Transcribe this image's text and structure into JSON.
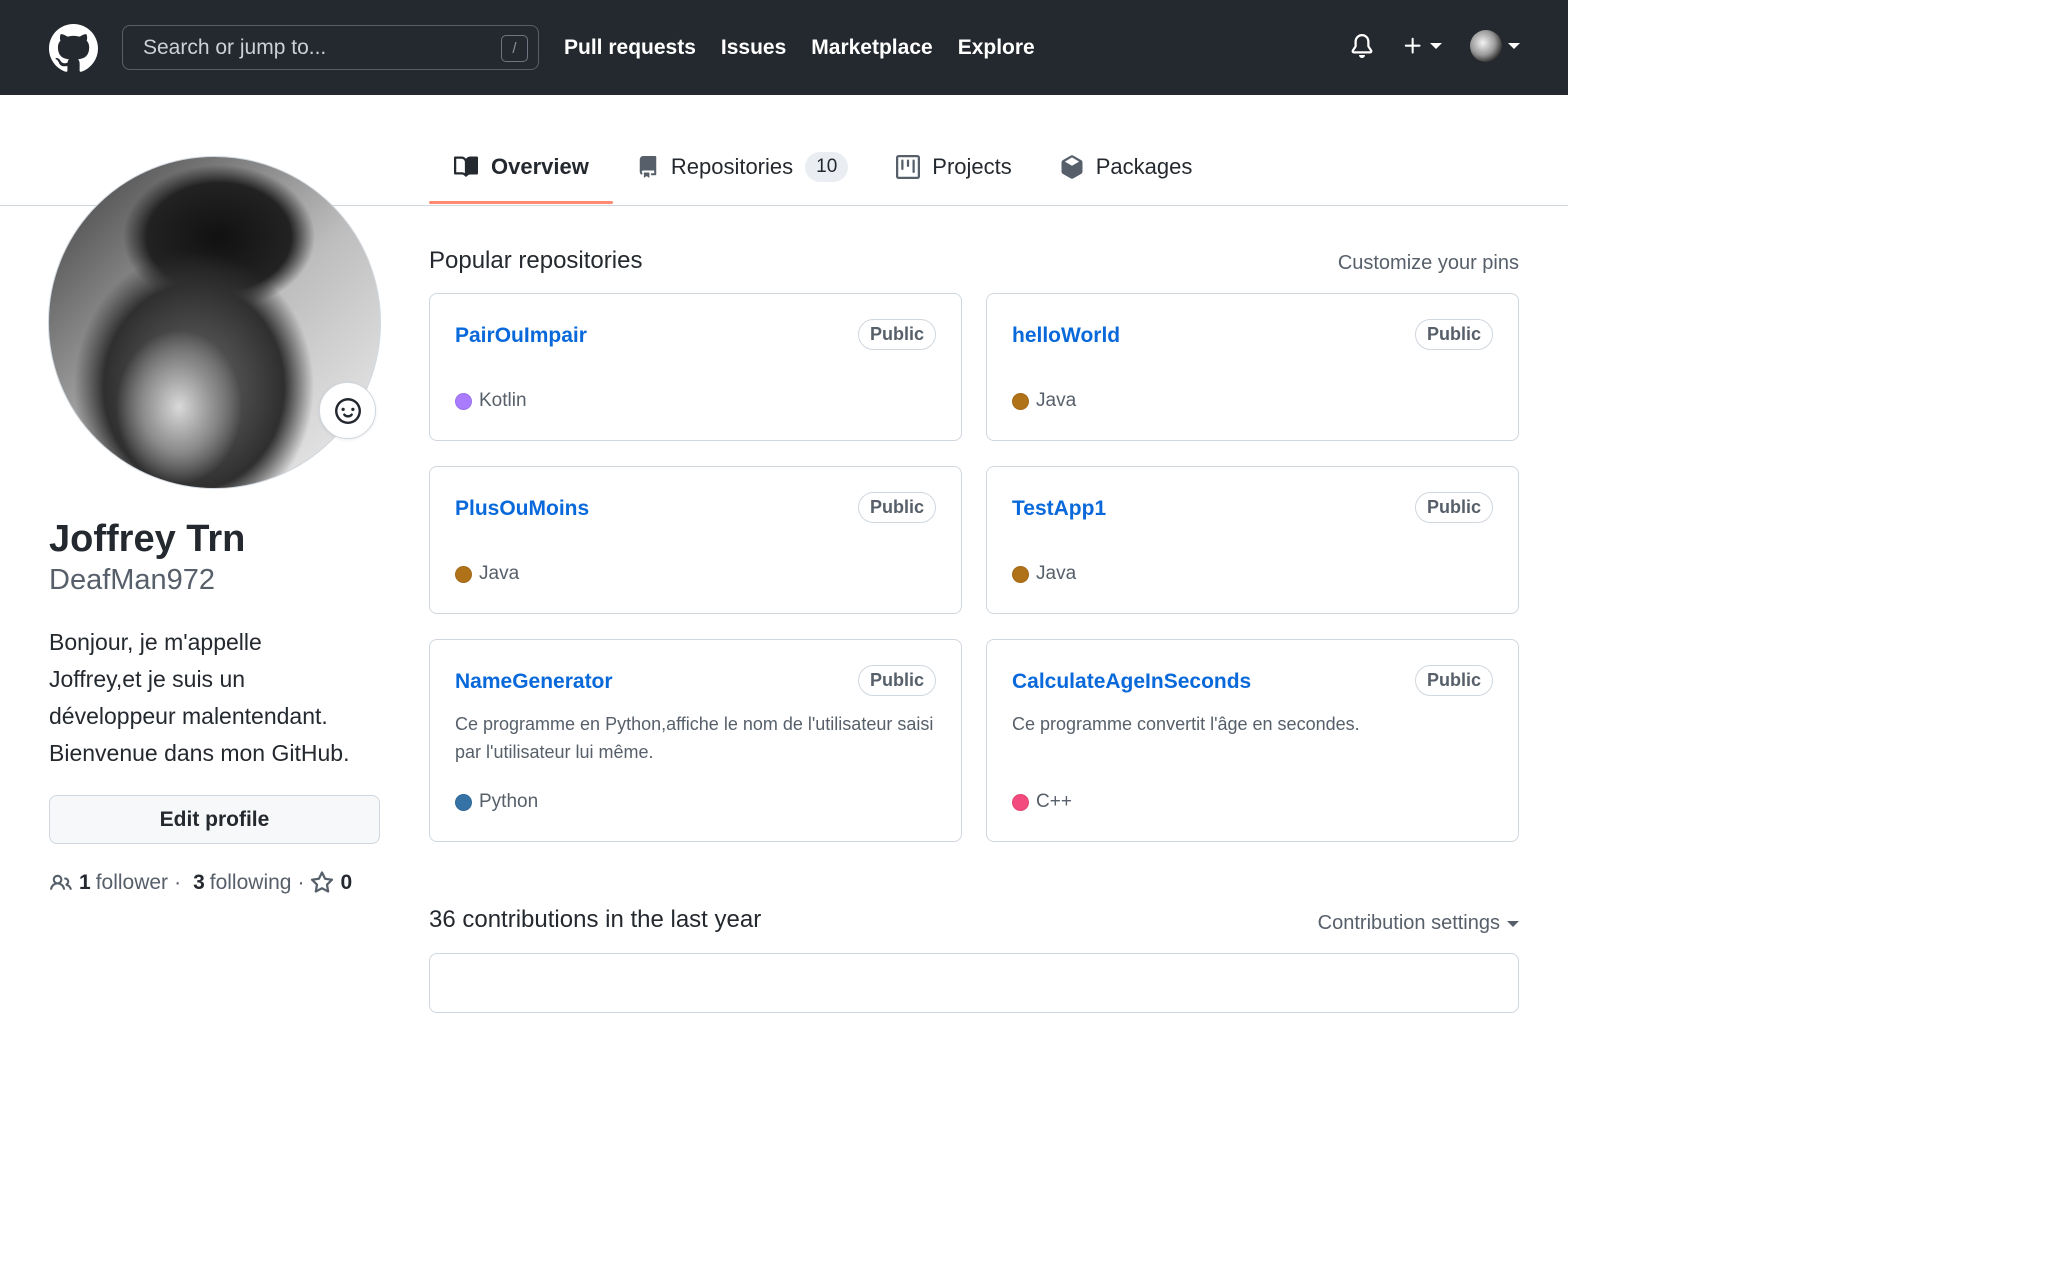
{
  "header": {
    "search_placeholder": "Search or jump to...",
    "search_shortcut": "/",
    "nav": [
      "Pull requests",
      "Issues",
      "Marketplace",
      "Explore"
    ],
    "plus_label": "+"
  },
  "tabs": {
    "overview": "Overview",
    "repositories": "Repositories",
    "repositories_count": "10",
    "projects": "Projects",
    "packages": "Packages"
  },
  "profile": {
    "name": "Joffrey Trn",
    "login": "DeafMan972",
    "bio_lines": [
      "Bonjour, je m'appelle",
      "Joffrey,et je suis un",
      "développeur malentendant.",
      "Bienvenue dans mon GitHub."
    ],
    "edit_button": "Edit profile",
    "followers_count": "1",
    "followers_label": "follower",
    "following_count": "3",
    "following_label": "following",
    "stars_count": "0"
  },
  "popular": {
    "title": "Popular repositories",
    "customize": "Customize your pins",
    "repos": [
      {
        "name": "PairOuImpair",
        "visibility": "Public",
        "description": "",
        "language": "Kotlin",
        "language_color": "#A97BFF"
      },
      {
        "name": "helloWorld",
        "visibility": "Public",
        "description": "",
        "language": "Java",
        "language_color": "#b07219"
      },
      {
        "name": "PlusOuMoins",
        "visibility": "Public",
        "description": "",
        "language": "Java",
        "language_color": "#b07219"
      },
      {
        "name": "TestApp1",
        "visibility": "Public",
        "description": "",
        "language": "Java",
        "language_color": "#b07219"
      },
      {
        "name": "NameGenerator",
        "visibility": "Public",
        "description": "Ce programme en Python,affiche le nom de l'utilisateur saisi par l'utilisateur lui même.",
        "language": "Python",
        "language_color": "#3572A5"
      },
      {
        "name": "CalculateAgeInSeconds",
        "visibility": "Public",
        "description": "Ce programme convertit l'âge en secondes.",
        "language": "C++",
        "language_color": "#f34b7d"
      }
    ]
  },
  "contributions": {
    "title": "36 contributions in the last year",
    "settings": "Contribution settings"
  }
}
